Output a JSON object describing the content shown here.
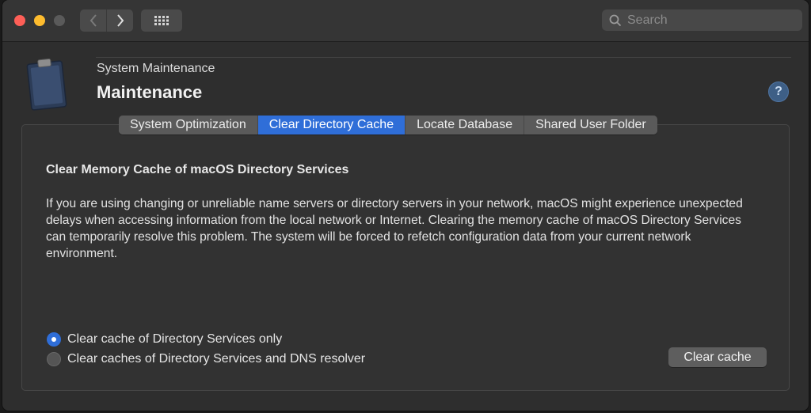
{
  "window": {
    "search_placeholder": "Search"
  },
  "header": {
    "subtitle": "System Maintenance",
    "title": "Maintenance",
    "help_label": "?"
  },
  "tabs": [
    {
      "label": "System Optimization",
      "active": false
    },
    {
      "label": "Clear Directory Cache",
      "active": true
    },
    {
      "label": "Locate Database",
      "active": false
    },
    {
      "label": "Shared User Folder",
      "active": false
    }
  ],
  "content": {
    "section_title": "Clear Memory Cache of macOS Directory Services",
    "description": "If you are using changing or unreliable name servers or directory servers in your network, macOS might experience unexpected delays when accessing information from the local network or Internet. Clearing the memory cache of macOS Directory Services can temporarily resolve this problem. The system will be forced to refetch configuration data from your current network environment.",
    "options": [
      {
        "label": "Clear cache of Directory Services only",
        "selected": true
      },
      {
        "label": "Clear caches of Directory Services and DNS resolver",
        "selected": false
      }
    ],
    "clear_button": "Clear cache"
  },
  "colors": {
    "accent": "#2f6ed8",
    "close": "#fe5f57",
    "minimize": "#febc2e"
  },
  "icons": [
    "back-chevron-icon",
    "forward-chevron-icon",
    "grid-icon",
    "search-icon",
    "clipboard-icon",
    "help-icon"
  ]
}
